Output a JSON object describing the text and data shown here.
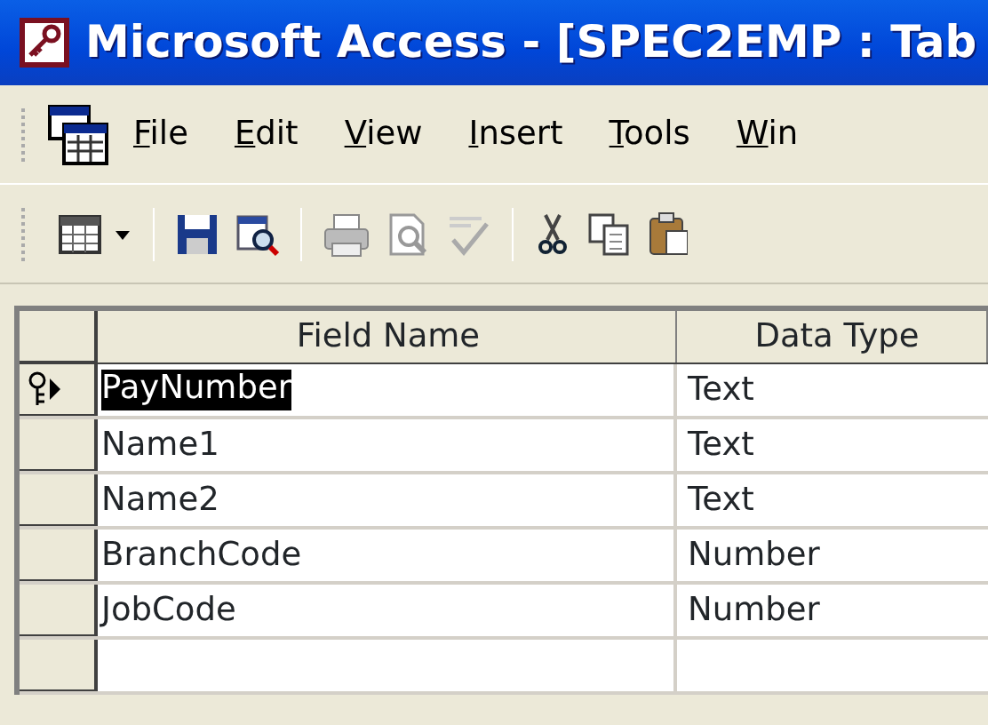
{
  "window": {
    "title": "Microsoft Access - [SPEC2EMP : Tab"
  },
  "menu": [
    "File",
    "Edit",
    "View",
    "Insert",
    "Tools",
    "Win"
  ],
  "toolbar": [
    {
      "kind": "view-table"
    },
    {
      "kind": "sep"
    },
    {
      "kind": "save"
    },
    {
      "kind": "properties"
    },
    {
      "kind": "sep"
    },
    {
      "kind": "print"
    },
    {
      "kind": "preview"
    },
    {
      "kind": "spelling"
    },
    {
      "kind": "sep"
    },
    {
      "kind": "cut"
    },
    {
      "kind": "copy"
    },
    {
      "kind": "paste"
    }
  ],
  "table": {
    "columns": [
      "Field Name",
      "Data Type"
    ],
    "rows": [
      {
        "field_name": "PayNumber",
        "data_type": "Text",
        "primary_key": true,
        "current": true,
        "selected": true
      },
      {
        "field_name": "Name1",
        "data_type": "Text",
        "primary_key": false,
        "current": false,
        "selected": false
      },
      {
        "field_name": "Name2",
        "data_type": "Text",
        "primary_key": false,
        "current": false,
        "selected": false
      },
      {
        "field_name": "BranchCode",
        "data_type": "Number",
        "primary_key": false,
        "current": false,
        "selected": false
      },
      {
        "field_name": "JobCode",
        "data_type": "Number",
        "primary_key": false,
        "current": false,
        "selected": false
      }
    ]
  }
}
